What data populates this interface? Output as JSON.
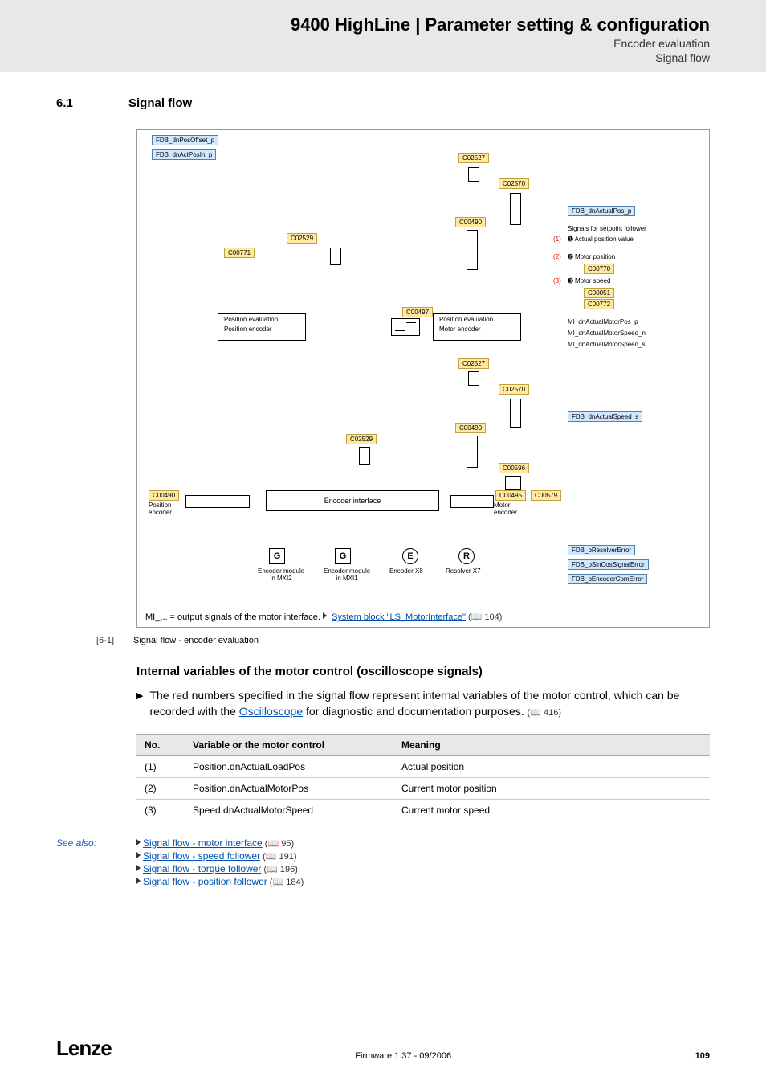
{
  "header": {
    "title": "9400 HighLine | Parameter setting & configuration",
    "sub1": "Encoder evaluation",
    "sub2": "Signal flow"
  },
  "section": {
    "num": "6.1",
    "title": "Signal flow"
  },
  "diagram": {
    "sig_in1": "FDB_dnPosOffset_p",
    "sig_in2": "FDB_dnActPosIn_p",
    "c02527a": "C02527",
    "c02570a": "C02570",
    "c00490top": "C00490",
    "c02529a": "C02529",
    "c00771": "C00771",
    "c00497": "C00497",
    "sig_fdbActualPos": "FDB_dnActualPos_p",
    "setpoint_text": "Signals for setpoint follower",
    "bullet1": "Actual position value",
    "bullet2": "Motor position",
    "bullet3": "Motor speed",
    "c00770": "C00770",
    "c00051": "C00051",
    "c00772": "C00772",
    "mi1": "MI_dnActualMotorPos_p",
    "mi2": "MI_dnActualMotorSpeed_n",
    "mi3": "MI_dnActualMotorSpeed_s",
    "pos_eval": "Position evaluation",
    "pos_enc": "Position encoder",
    "mot_enc": "Motor encoder",
    "c02527b": "C02527",
    "c02570b": "C02570",
    "c00490mid": "C00490",
    "c02529b": "C02529",
    "c00596": "C00596",
    "fdbActualSpeed": "FDB_dnActualSpeed_s",
    "c00490btm": "C00490",
    "c00495": "C00495",
    "c00579": "C00579",
    "enc_if": "Encoder interface",
    "pos_encoder_lbl": "Position\nencoder",
    "mot_encoder_lbl": "Motor\nencoder",
    "g1": "G",
    "g2": "G",
    "e": "E",
    "r": "R",
    "enc_mod_mxi2": "Encoder module\nin MXI2",
    "enc_mod_mxi1": "Encoder module\nin MXI1",
    "enc_x8": "Encoder X8",
    "res_x7": "Resolver X7",
    "fdb_res_err": "FDB_bResolverError",
    "fdb_sincos": "FDB_bSinCosSignalError",
    "fdb_enc_com": "FDB_bEncoderComError",
    "footnote_pre": "MI_... = output signals of the motor interface.  ",
    "footnote_link": "System block \"LS_MotorInterface\"",
    "footnote_ref": " (📖 104)",
    "red1": "(1)",
    "red2": "(2)",
    "red3": "(3)",
    "num1": "➊",
    "num2": "➋",
    "num3": "➌"
  },
  "caption": {
    "num": "[6-1]",
    "text": "Signal flow - encoder evaluation"
  },
  "subhead": "Internal variables of the motor control (oscilloscope signals)",
  "bullet": {
    "pre": "The red numbers specified in the signal flow represent internal variables of the motor control, which can be recorded with the ",
    "link": "Oscilloscope",
    "post": " for diagnostic and documentation purposes.",
    "ref": " (📖 416)"
  },
  "table": {
    "h1": "No.",
    "h2": "Variable or the motor control",
    "h3": "Meaning",
    "rows": [
      {
        "n": "(1)",
        "v": "Position.dnActualLoadPos",
        "m": "Actual position"
      },
      {
        "n": "(2)",
        "v": "Position.dnActualMotorPos",
        "m": "Current motor position"
      },
      {
        "n": "(3)",
        "v": "Speed.dnActualMotorSpeed",
        "m": "Current motor speed"
      }
    ]
  },
  "seealso": {
    "label": "See also:",
    "items": [
      {
        "t": "Signal flow - motor interface",
        "r": " (📖 95)"
      },
      {
        "t": "Signal flow - speed follower",
        "r": " (📖 191)"
      },
      {
        "t": "Signal flow - torque follower",
        "r": " (📖 196)"
      },
      {
        "t": "Signal flow - position follower",
        "r": " (📖 184)"
      }
    ]
  },
  "footer": {
    "logo": "Lenze",
    "center": "Firmware 1.37 - 09/2006",
    "page": "109"
  }
}
